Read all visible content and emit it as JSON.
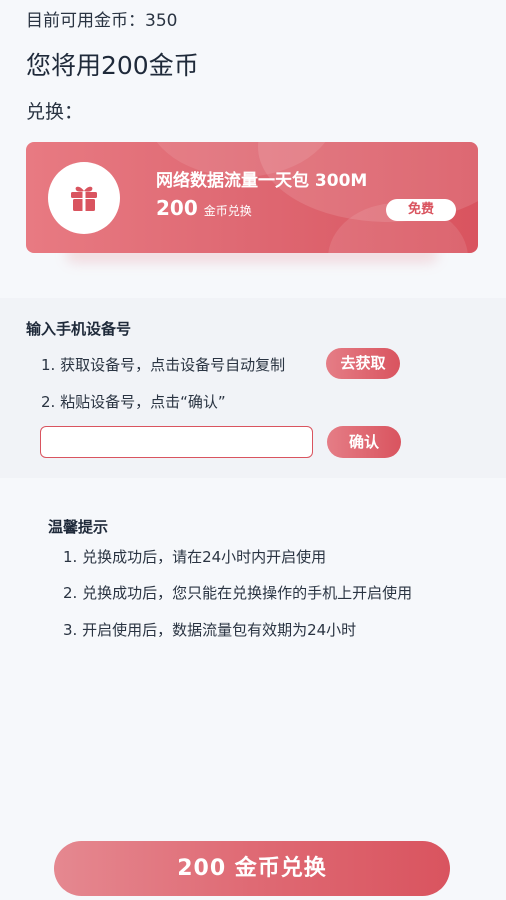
{
  "header": {
    "balance": "目前可用金币：350",
    "title": "您将用200金币",
    "exchange_label": "兑换："
  },
  "product": {
    "icon": "gift-icon",
    "name": "网络数据流量一天包 300M",
    "price": "200",
    "price_unit": "金币兑换",
    "badge": "免费"
  },
  "device": {
    "title": "输入手机设备号",
    "step1": "1. 获取设备号，点击设备号自动复制",
    "get_button": "去获取",
    "step2": "2. 粘贴设备号，点击“确认”",
    "input_value": "",
    "input_placeholder": "",
    "confirm_button": "确认"
  },
  "tips": {
    "title": "温馨提示",
    "items": [
      "1. 兑换成功后，请在24小时内开启使用",
      "2. 兑换成功后，您只能在兑换操作的手机上开启使用",
      "3. 开启使用后，数据流量包有效期为24小时"
    ]
  },
  "footer": {
    "redeem_button": "200 金币兑换"
  },
  "colors": {
    "accent": "#d9545f",
    "accent_light": "#e87a82",
    "background": "#f6f8fb"
  }
}
